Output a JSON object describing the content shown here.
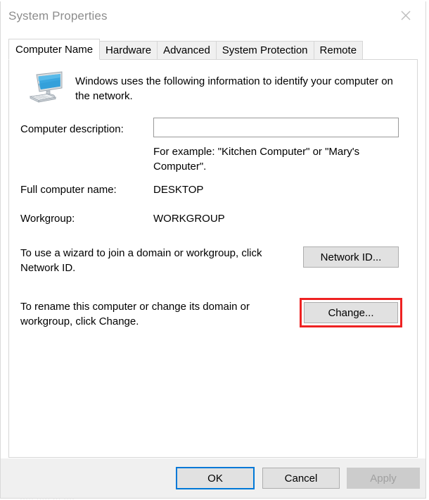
{
  "window": {
    "title": "System Properties",
    "close_icon": "close-icon",
    "ghost_top": "·········",
    "ghost_bottom": "····· ····· ··· ····"
  },
  "tabs": [
    {
      "label": "Computer Name",
      "active": true
    },
    {
      "label": "Hardware",
      "active": false
    },
    {
      "label": "Advanced",
      "active": false
    },
    {
      "label": "System Protection",
      "active": false
    },
    {
      "label": "Remote",
      "active": false
    }
  ],
  "page": {
    "icon_name": "computer-monitor-icon",
    "intro": "Windows uses the following information to identify your computer on the network.",
    "description": {
      "label": "Computer description:",
      "value": "",
      "placeholder": "",
      "hint": "For example: \"Kitchen Computer\" or \"Mary's Computer\"."
    },
    "full_computer_name": {
      "label": "Full computer name:",
      "value": "DESKTOP"
    },
    "workgroup": {
      "label": "Workgroup:",
      "value": "WORKGROUP"
    },
    "network_id": {
      "text": "To use a wizard to join a domain or workgroup, click Network ID.",
      "button": "Network ID..."
    },
    "change": {
      "text": "To rename this computer or change its domain or workgroup, click Change.",
      "button": "Change...",
      "highlight_color": "#ee2222"
    }
  },
  "footer": {
    "ok": "OK",
    "cancel": "Cancel",
    "apply": "Apply",
    "focus_color": "#0078d7"
  }
}
